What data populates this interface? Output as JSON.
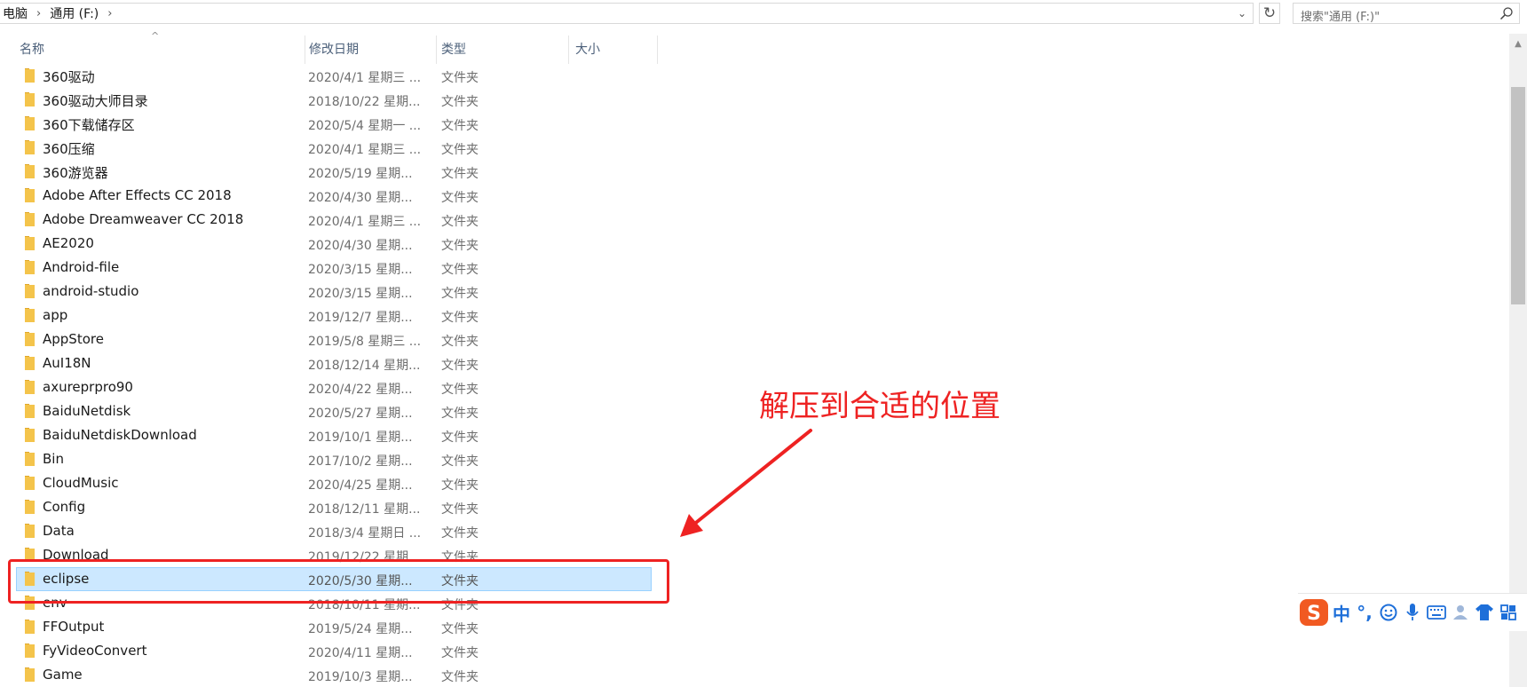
{
  "address": {
    "crumbs": [
      "电脑",
      "通用 (F:)"
    ],
    "separator": "›",
    "dropdown_glyph": "⌄",
    "refresh_glyph": "↻"
  },
  "search": {
    "placeholder": "搜索\"通用 (F:)\""
  },
  "columns": {
    "name": "名称",
    "date": "修改日期",
    "type": "类型",
    "size": "大小",
    "sort_glyph": "^"
  },
  "rows": [
    {
      "name": "360驱动",
      "date": "2020/4/1 星期三 ...",
      "type": "文件夹"
    },
    {
      "name": "360驱动大师目录",
      "date": "2018/10/22 星期...",
      "type": "文件夹"
    },
    {
      "name": "360下载储存区",
      "date": "2020/5/4 星期一 ...",
      "type": "文件夹"
    },
    {
      "name": "360压缩",
      "date": "2020/4/1 星期三 ...",
      "type": "文件夹"
    },
    {
      "name": "360游览器",
      "date": "2020/5/19 星期...",
      "type": "文件夹"
    },
    {
      "name": "Adobe After Effects CC 2018",
      "date": "2020/4/30 星期...",
      "type": "文件夹"
    },
    {
      "name": "Adobe Dreamweaver CC 2018",
      "date": "2020/4/1 星期三 ...",
      "type": "文件夹"
    },
    {
      "name": "AE2020",
      "date": "2020/4/30 星期...",
      "type": "文件夹"
    },
    {
      "name": "Android-file",
      "date": "2020/3/15 星期...",
      "type": "文件夹"
    },
    {
      "name": "android-studio",
      "date": "2020/3/15 星期...",
      "type": "文件夹"
    },
    {
      "name": "app",
      "date": "2019/12/7 星期...",
      "type": "文件夹"
    },
    {
      "name": "AppStore",
      "date": "2019/5/8 星期三 ...",
      "type": "文件夹"
    },
    {
      "name": "AuI18N",
      "date": "2018/12/14 星期...",
      "type": "文件夹"
    },
    {
      "name": "axureprpro90",
      "date": "2020/4/22 星期...",
      "type": "文件夹"
    },
    {
      "name": "BaiduNetdisk",
      "date": "2020/5/27 星期...",
      "type": "文件夹"
    },
    {
      "name": "BaiduNetdiskDownload",
      "date": "2019/10/1 星期...",
      "type": "文件夹"
    },
    {
      "name": "Bin",
      "date": "2017/10/2 星期...",
      "type": "文件夹"
    },
    {
      "name": "CloudMusic",
      "date": "2020/4/25 星期...",
      "type": "文件夹"
    },
    {
      "name": "Config",
      "date": "2018/12/11 星期...",
      "type": "文件夹"
    },
    {
      "name": "Data",
      "date": "2018/3/4 星期日 ...",
      "type": "文件夹"
    },
    {
      "name": "Download",
      "date": "2019/12/22 星期...",
      "type": "文件夹"
    },
    {
      "name": "eclipse",
      "date": "2020/5/30 星期...",
      "type": "文件夹",
      "selected": true
    },
    {
      "name": "env",
      "date": "2018/10/11 星期...",
      "type": "文件夹"
    },
    {
      "name": "FFOutput",
      "date": "2019/5/24 星期...",
      "type": "文件夹"
    },
    {
      "name": "FyVideoConvert",
      "date": "2020/4/11 星期...",
      "type": "文件夹"
    },
    {
      "name": "Game",
      "date": "2019/10/3 星期...",
      "type": "文件夹"
    }
  ],
  "annotation": {
    "text": "解压到合适的位置",
    "color": "#ee2222"
  },
  "ime": {
    "logo_letter": "S",
    "lang": "中",
    "punct": "°,",
    "icons": [
      "emoji-icon",
      "microphone-icon",
      "keyboard-icon",
      "skin-icon",
      "shirt-icon",
      "grid-menu-icon"
    ]
  },
  "colors": {
    "folder": "#f4c44b",
    "selection_bg": "#cce8ff",
    "selection_border": "#99d1ff",
    "header_text": "#4c607a",
    "ime_blue": "#1e6fd9",
    "ime_red": "#f15a22"
  }
}
